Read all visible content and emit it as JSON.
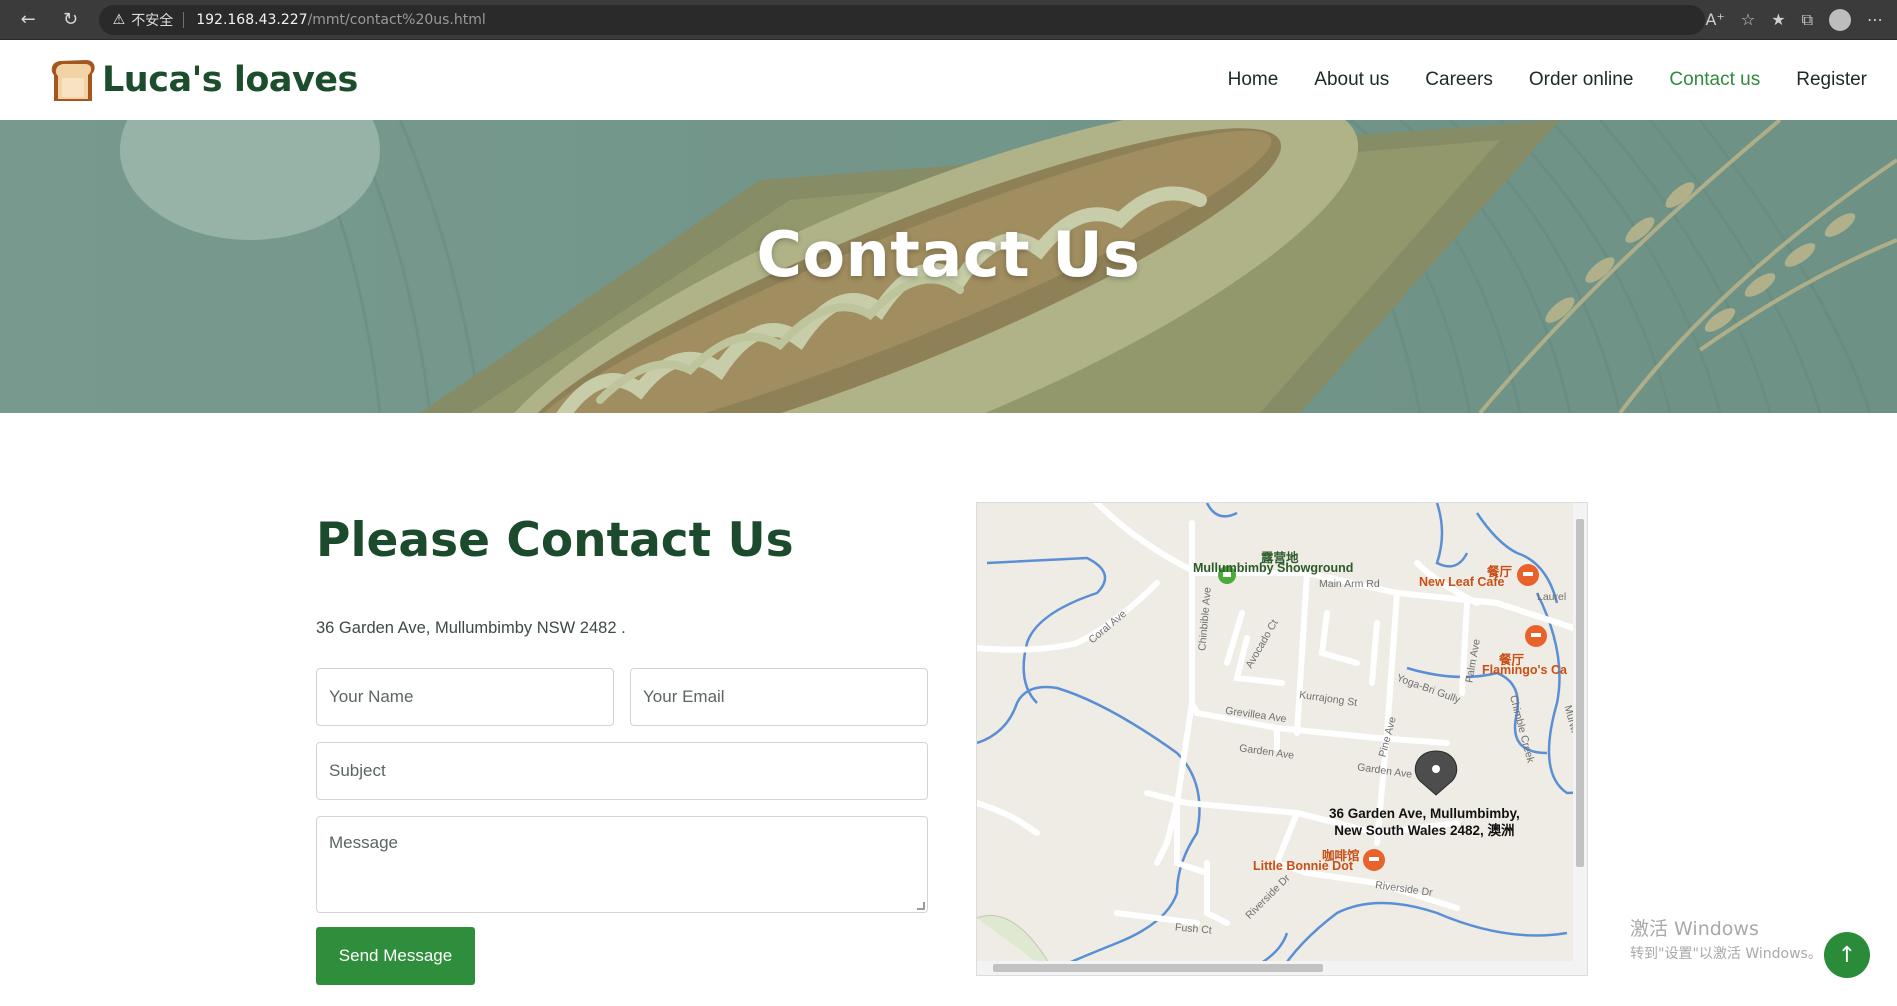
{
  "browser": {
    "insecure_label": "不安全",
    "url_host": "192.168.43.227",
    "url_path": "/mmt/contact%20us.html"
  },
  "site": {
    "brand": "Luca's loaves",
    "nav": [
      {
        "label": "Home"
      },
      {
        "label": "About us"
      },
      {
        "label": "Careers"
      },
      {
        "label": "Order online"
      },
      {
        "label": "Contact us",
        "active": true
      },
      {
        "label": "Register"
      }
    ],
    "accent_color": "#2e8b3d",
    "brand_color": "#1c4d2c"
  },
  "hero": {
    "title": "Contact Us"
  },
  "contact": {
    "heading": "Please Contact Us",
    "address": "36 Garden Ave, Mullumbimby NSW 2482 .",
    "form": {
      "name_placeholder": "Your Name",
      "email_placeholder": "Your Email",
      "subject_placeholder": "Subject",
      "message_placeholder": "Message",
      "submit_label": "Send Message"
    }
  },
  "map": {
    "places": {
      "showground_cn": "露营地",
      "showground": "Mullumbimby Showground",
      "newleaf_cn": "餐厅",
      "newleaf": "New Leaf Cafe",
      "flamingo_cn": "餐厅",
      "flamingo": "Flamingo's Ca",
      "bonnie_cn": "咖啡馆",
      "bonnie": "Little Bonnie Dot"
    },
    "roads": {
      "main_arm": "Main Arm Rd",
      "laurel": "Laurel",
      "coral": "Coral Ave",
      "chinchilla": "Chinbible Ave",
      "avocado": "Avocado Ct",
      "kurrajong": "Kurrajong St",
      "grevillea": "Grevillea Ave",
      "garden1": "Garden Ave",
      "garden2": "Garden Ave",
      "pine": "Pine Ave",
      "palm": "Palm Ave",
      "gully": "Yoga-Bri Gully",
      "creek": "Chimble Creek",
      "murwill": "Murwi",
      "riverside1": "Riverside Dr",
      "riverside2": "Riverside Dr",
      "fush": "Fush Ct"
    },
    "marker_label_1": "36 Garden Ave, Mullumbimby,",
    "marker_label_2": "New South Wales 2482, 澳洲"
  },
  "os_watermark": {
    "line1": "激活 Windows",
    "line2": "转到\"设置\"以激活 Windows。"
  }
}
